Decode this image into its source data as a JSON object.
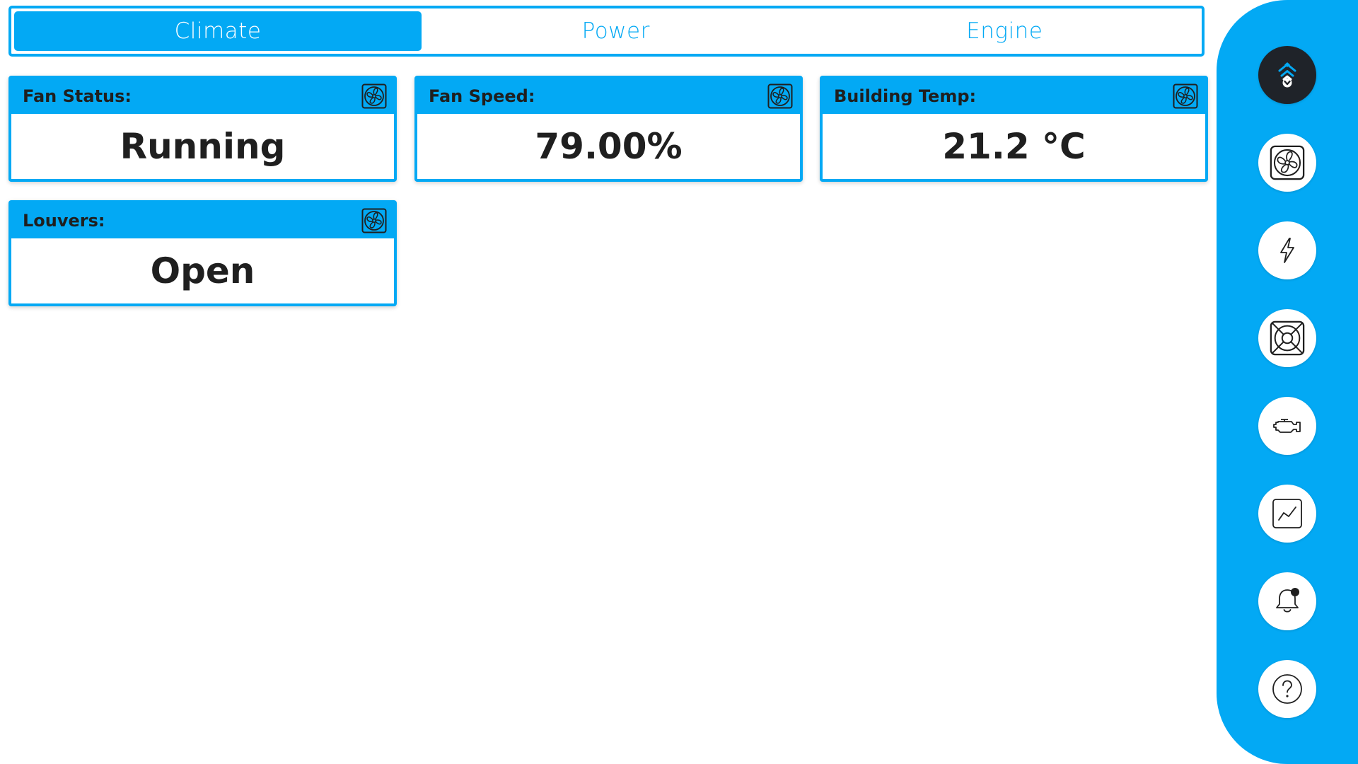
{
  "tabs": [
    {
      "label": "Climate",
      "active": true
    },
    {
      "label": "Power",
      "active": false
    },
    {
      "label": "Engine",
      "active": false
    }
  ],
  "cards": [
    {
      "title": "Fan Status:",
      "value": "Running",
      "icon": "fan-icon"
    },
    {
      "title": "Fan Speed:",
      "value": "79.00%",
      "icon": "fan-icon"
    },
    {
      "title": "Building Temp:",
      "value": "21.2 °C",
      "icon": "fan-icon"
    },
    {
      "title": "Louvers:",
      "value": "Open",
      "icon": "fan-icon"
    }
  ],
  "sidebar": {
    "items": [
      {
        "icon": "home-logo-icon"
      },
      {
        "icon": "fan-icon"
      },
      {
        "icon": "lightning-icon"
      },
      {
        "icon": "ventilation-icon"
      },
      {
        "icon": "engine-icon"
      },
      {
        "icon": "chart-icon"
      },
      {
        "icon": "bell-icon"
      },
      {
        "icon": "help-icon"
      }
    ]
  },
  "colors": {
    "accent": "#03A9F4",
    "text": "#1f1f1f",
    "home_button": "#1f2329",
    "background": "#ffffff"
  }
}
